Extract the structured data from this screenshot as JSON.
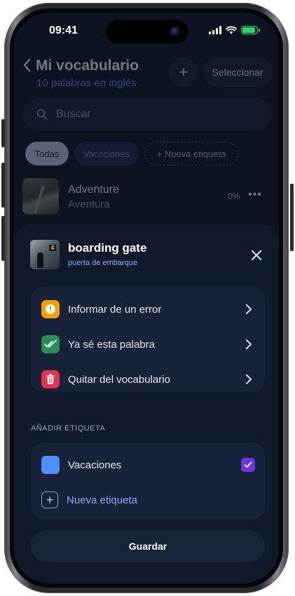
{
  "status_bar": {
    "time": "09:41"
  },
  "header": {
    "title": "Mi vocabulario",
    "subtitle": "10 palabras en inglés",
    "add_label": "+",
    "select_label": "Seleccionar"
  },
  "search": {
    "placeholder": "Buscar"
  },
  "filters": {
    "all": "Todas",
    "vacations": "Vacaciones",
    "new_tag": "+ Nueva etiqueta"
  },
  "word_row": {
    "english": "Adventure",
    "spanish": "Aventura",
    "progress": "0%",
    "more": "•••"
  },
  "sheet": {
    "word": "boarding gate",
    "translation": "puerta de embarque",
    "actions": [
      {
        "label": "Informar de un error",
        "icon": "warning-icon",
        "color": "#f59e0b"
      },
      {
        "label": "Ya sé esta palabra",
        "icon": "double-check-icon",
        "color": "#2e8b5f"
      },
      {
        "label": "Quitar del vocabulario",
        "icon": "trash-icon",
        "color": "#e0344f"
      }
    ],
    "tags_heading": "AÑADIR ETIQUETA",
    "tags": [
      {
        "label": "Vacaciones",
        "checked": true,
        "color": "#4a90ff"
      }
    ],
    "new_tag_label": "Nueva etiqueta",
    "save_label": "Guardar"
  },
  "colors": {
    "accent": "#6f8cff",
    "checkbox": "#6d35e6",
    "background": "#0d1321"
  }
}
